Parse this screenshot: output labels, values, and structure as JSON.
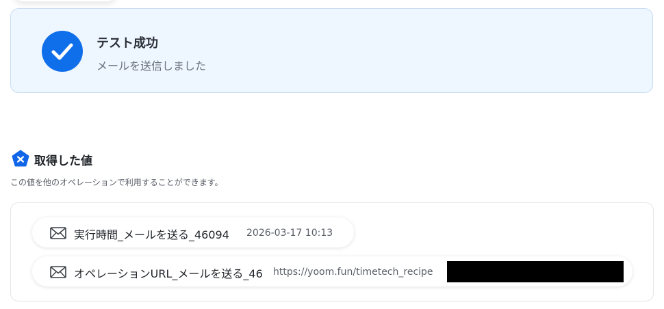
{
  "success": {
    "title": "テスト成功",
    "message": "メールを送信しました",
    "icon": "check-icon",
    "accent_color": "#0f6fea",
    "background_color": "#eef6ff"
  },
  "obtained_values": {
    "title": "取得した値",
    "description": "この値を他のオペレーションで利用することができます。",
    "icon": "yoom-badge-icon",
    "items": [
      {
        "icon": "mail-icon",
        "label": "実行時間_メールを送る_46094",
        "value": "2026-03-17 10:13"
      },
      {
        "icon": "mail-icon",
        "label": "オペレーションURL_メールを送る_46",
        "value": "https://yoom.fun/timetech_recipe"
      }
    ]
  }
}
